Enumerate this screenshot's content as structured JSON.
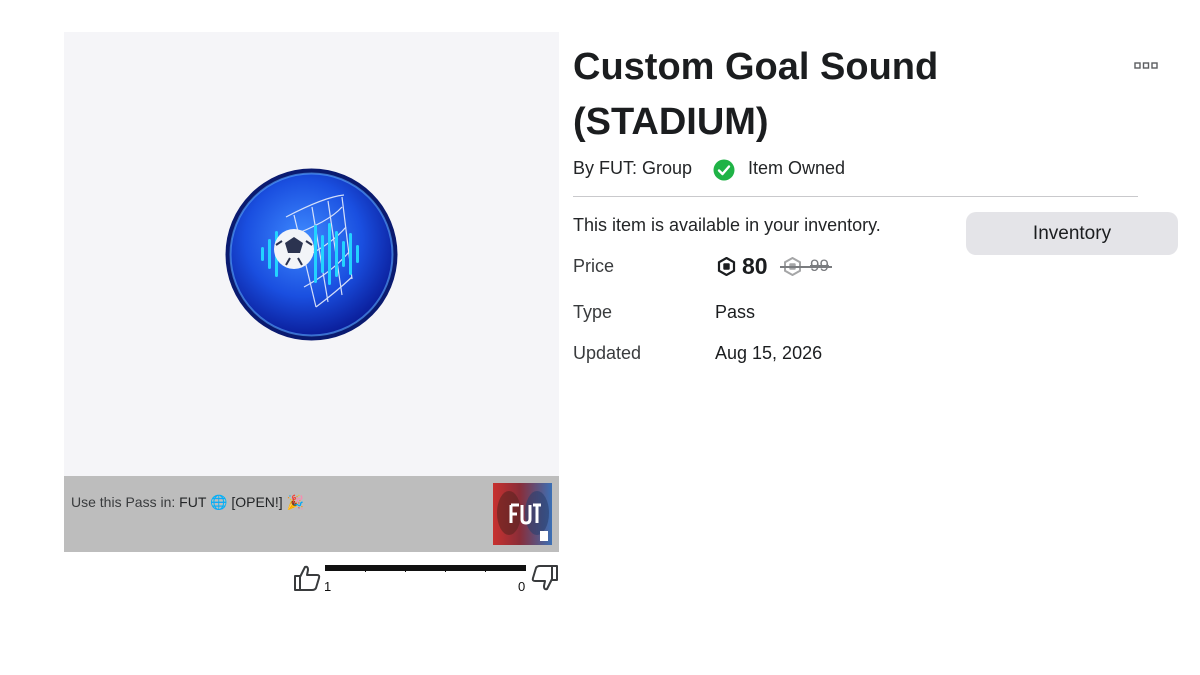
{
  "item": {
    "title": "Custom Goal Sound (STADIUM)",
    "creator": "By FUT: Group",
    "owned_label": "Item Owned",
    "availability": "This item is available in your inventory.",
    "inventory_button": "Inventory"
  },
  "details": {
    "price_label": "Price",
    "price": "80",
    "original_price": "99",
    "type_label": "Type",
    "type": "Pass",
    "updated_label": "Updated",
    "updated": "Aug 15, 2026"
  },
  "usage": {
    "prefix": "Use this Pass in:",
    "game_name": "FUT",
    "game_suffix": "[OPEN!]"
  },
  "votes": {
    "up": "1",
    "down": "0"
  },
  "icons": {
    "thumbnail": "soccer-ball-goal-sound-icon",
    "owned": "check-circle-icon",
    "currency": "robux-icon",
    "more": "more-options-icon",
    "like": "thumbs-up-icon",
    "dislike": "thumbs-down-icon"
  },
  "colors": {
    "owned_green": "#1fb346",
    "thumbnail_blue": "#1a4fe0",
    "button_bg": "#e4e4e8"
  }
}
